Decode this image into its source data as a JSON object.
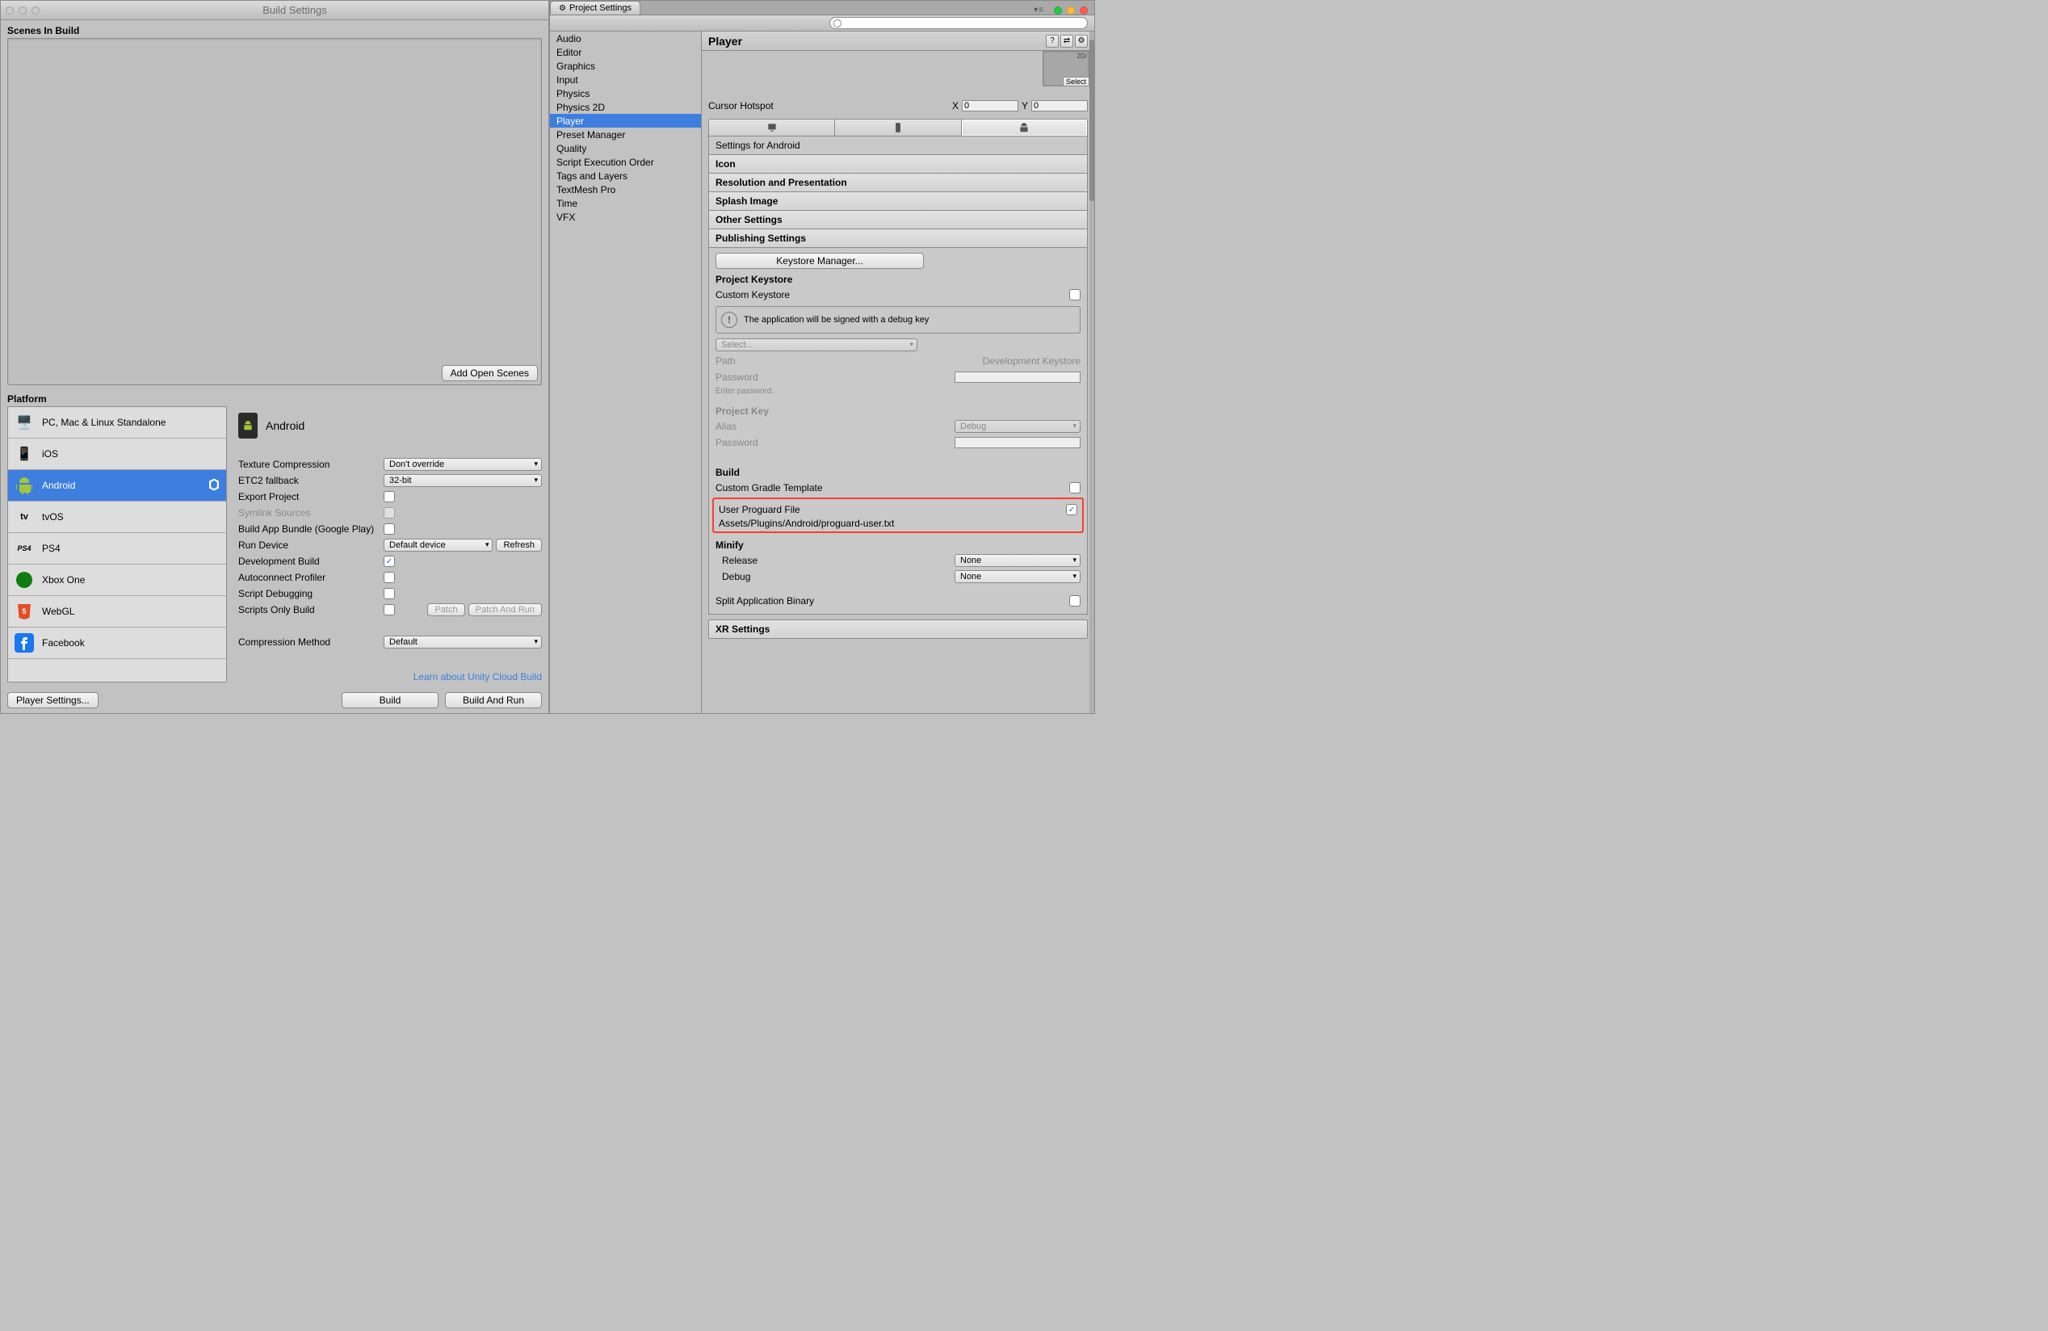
{
  "buildSettings": {
    "windowTitle": "Build Settings",
    "scenesLabel": "Scenes In Build",
    "addOpenScenes": "Add Open Scenes",
    "platformLabel": "Platform",
    "platforms": [
      "PC, Mac & Linux Standalone",
      "iOS",
      "Android",
      "tvOS",
      "PS4",
      "Xbox One",
      "WebGL",
      "Facebook"
    ],
    "selectedPlatform": "Android",
    "options": {
      "textureCompressionLabel": "Texture Compression",
      "textureCompressionValue": "Don't override",
      "etc2FallbackLabel": "ETC2 fallback",
      "etc2FallbackValue": "32-bit",
      "exportProjectLabel": "Export Project",
      "symlinkSourcesLabel": "Symlink Sources",
      "buildAppBundleLabel": "Build App Bundle (Google Play)",
      "runDeviceLabel": "Run Device",
      "runDeviceValue": "Default device",
      "refreshLabel": "Refresh",
      "devBuildLabel": "Development Build",
      "autoconnectProfilerLabel": "Autoconnect Profiler",
      "scriptDebuggingLabel": "Script Debugging",
      "scriptsOnlyBuildLabel": "Scripts Only Build",
      "patchLabel": "Patch",
      "patchAndRunLabel": "Patch And Run",
      "compressionMethodLabel": "Compression Method",
      "compressionMethodValue": "Default"
    },
    "learnLink": "Learn about Unity Cloud Build",
    "playerSettingsBtn": "Player Settings...",
    "buildBtn": "Build",
    "buildAndRunBtn": "Build And Run"
  },
  "projectSettings": {
    "tabTitle": "Project Settings",
    "searchPlaceholder": "",
    "categories": [
      "Audio",
      "Editor",
      "Graphics",
      "Input",
      "Physics",
      "Physics 2D",
      "Player",
      "Preset Manager",
      "Quality",
      "Script Execution Order",
      "Tags and Layers",
      "TextMesh Pro",
      "Time",
      "VFX"
    ],
    "selectedCategory": "Player",
    "panelTitle": "Player",
    "thumbLabel": "2D/",
    "thumbSelect": "Select",
    "cursorHotspotLabel": "Cursor Hotspot",
    "cursorX": "0",
    "cursorY": "0",
    "sfaLabel": "Settings for Android",
    "foldouts": {
      "icon": "Icon",
      "resolution": "Resolution and Presentation",
      "splash": "Splash Image",
      "other": "Other Settings",
      "publishing": "Publishing Settings",
      "xr": "XR Settings"
    },
    "publishing": {
      "keystoreManagerBtn": "Keystore Manager...",
      "projectKeystoreTitle": "Project Keystore",
      "customKeystoreLabel": "Custom Keystore",
      "debugKeyMsg": "The application will be signed with a debug key",
      "selectDropdown": "Select...",
      "pathLabel": "Path",
      "pathValue": "Development Keystore",
      "passwordLabel": "Password",
      "passwordHint": "Enter password.",
      "projectKeyTitle": "Project Key",
      "aliasLabel": "Alias",
      "aliasValue": "Debug",
      "keyPasswordLabel": "Password",
      "buildTitle": "Build",
      "customGradleLabel": "Custom Gradle Template",
      "userProguardLabel": "User Proguard File",
      "userProguardPath": "Assets/Plugins/Android/proguard-user.txt",
      "minifyTitle": "Minify",
      "releaseLabel": "Release",
      "releaseValue": "None",
      "debugLabel": "Debug",
      "debugValue": "None",
      "splitBinaryLabel": "Split Application Binary"
    }
  }
}
